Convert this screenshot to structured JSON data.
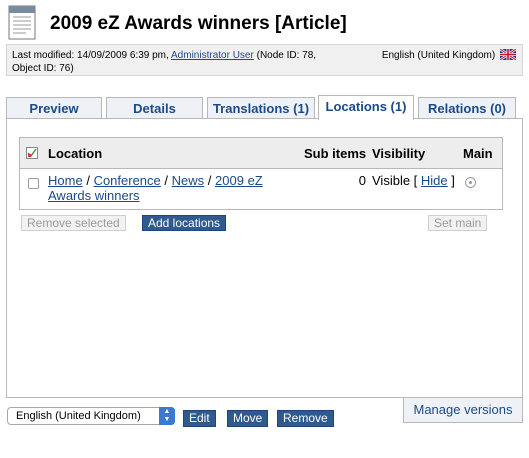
{
  "header": {
    "title": "2009 eZ Awards winners [Article]"
  },
  "meta": {
    "last_modified_prefix": "Last modified: 14/09/2009 6:39 pm,",
    "author": "Administrator User",
    "node_id_suffix": "(Node ID: 78,",
    "object_id": "Object ID: 76)",
    "language": "English (United Kingdom)"
  },
  "tabs": [
    {
      "label": "Preview",
      "active": false
    },
    {
      "label": "Details",
      "active": false
    },
    {
      "label": "Translations (1)",
      "active": false
    },
    {
      "label": "Locations (1)",
      "active": true
    },
    {
      "label": "Relations (0)",
      "active": false
    }
  ],
  "locations_table": {
    "columns": {
      "location": "Location",
      "sub_items": "Sub items",
      "visibility": "Visibility",
      "main": "Main"
    },
    "rows": [
      {
        "path": [
          "Home",
          "Conference",
          "News",
          "2009 eZ Awards winners"
        ],
        "separator": "/",
        "sub_items": "0",
        "visibility": "Visible",
        "visibility_action": "Hide"
      }
    ]
  },
  "actions": {
    "remove_selected": "Remove selected",
    "add_locations": "Add locations",
    "set_main": "Set main"
  },
  "footer": {
    "language_selected": "English (United Kingdom)",
    "edit": "Edit",
    "move": "Move",
    "remove": "Remove",
    "manage_versions": "Manage versions"
  },
  "colors": {
    "link": "#1b4a8a",
    "primary_button": "#2f5a8f",
    "tab_background": "#eef2f7"
  }
}
